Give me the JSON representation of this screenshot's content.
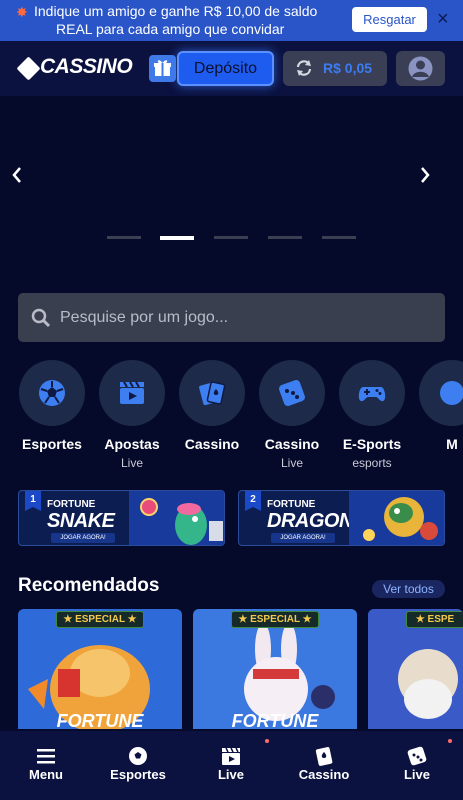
{
  "promo": {
    "line1": "Indique um amigo e ganhe R$ 10,00 de saldo",
    "line2": "REAL para cada amigo que convidar",
    "action": "Resgatar",
    "close": "×"
  },
  "header": {
    "logo": "CASSINO",
    "deposit_label": "Depósito",
    "balance": "R$ 0,05"
  },
  "search": {
    "placeholder": "Pesquise por um jogo..."
  },
  "categories": [
    {
      "label": "Esportes",
      "sub": "",
      "icon": "soccer-ball-icon"
    },
    {
      "label": "Apostas",
      "sub": "Live",
      "icon": "clapperboard-icon"
    },
    {
      "label": "Cassino",
      "sub": "",
      "icon": "cards-icon"
    },
    {
      "label": "Cassino",
      "sub": "Live",
      "icon": "dice-icon"
    },
    {
      "label": "E-Sports",
      "sub": "esports",
      "icon": "gamepad-icon"
    },
    {
      "label": "M",
      "sub": "",
      "icon": "more-icon"
    }
  ],
  "game_banners": [
    {
      "rank": "1",
      "sub": "FORTUNE",
      "title": "SNAKE",
      "cta": "JOGAR AGORA!"
    },
    {
      "rank": "2",
      "sub": "FORTUNE",
      "title": "DRAGON",
      "cta": "JOGAR AGORA!"
    }
  ],
  "recommended": {
    "title": "Recomendados",
    "see_all": "Ver todos",
    "games": [
      {
        "badge": "★ ESPECIAL ★",
        "title": "FORTUNE"
      },
      {
        "badge": "★ ESPECIAL ★",
        "title": "FORTUNE"
      },
      {
        "badge": "★ ESPE",
        "title": ""
      }
    ]
  },
  "bottom_nav": [
    {
      "label": "Menu",
      "icon": "hamburger-icon"
    },
    {
      "label": "Esportes",
      "icon": "soccer-ball-icon"
    },
    {
      "label": "Live",
      "icon": "clapperboard-icon"
    },
    {
      "label": "Cassino",
      "icon": "cards-icon"
    },
    {
      "label": "Live",
      "icon": "dice-icon"
    }
  ],
  "colors": {
    "promo_bg": "#2a55c9",
    "header_bg": "#0b1240",
    "page_bg": "#060a2a",
    "accent": "#1e5cf0",
    "balance_text": "#3c7cf2"
  }
}
